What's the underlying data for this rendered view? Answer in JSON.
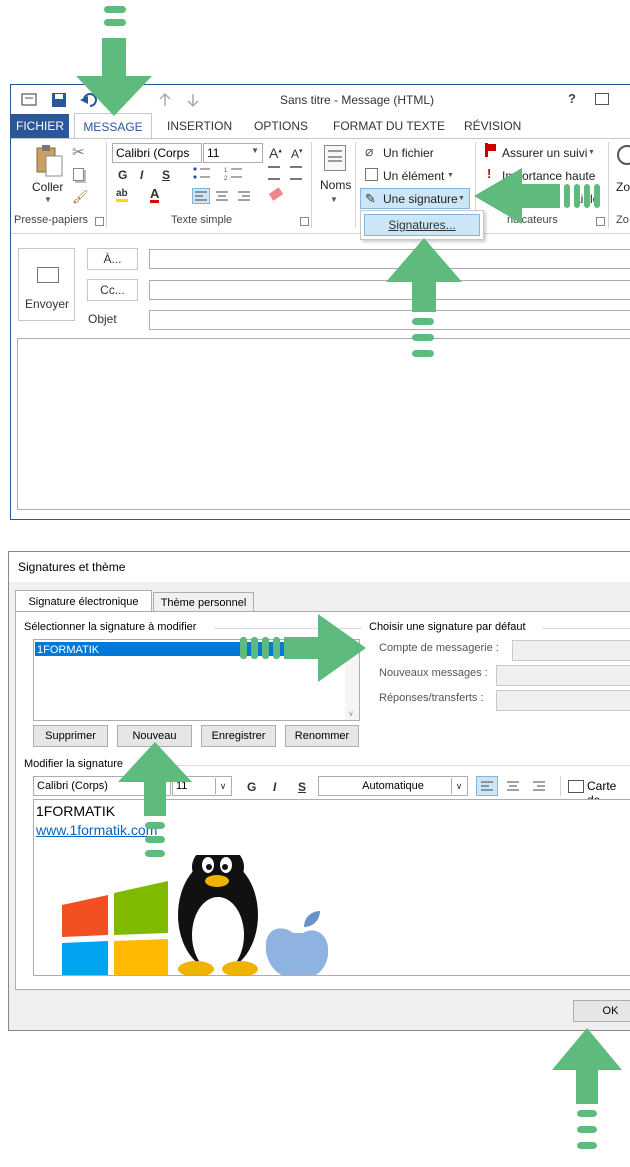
{
  "outlook": {
    "title": "Sans titre - Message (HTML)",
    "tabs": [
      "FICHIER",
      "MESSAGE",
      "INSERTION",
      "OPTIONS",
      "FORMAT DU TEXTE",
      "RÉVISION"
    ],
    "clipboard": {
      "paste": "Coller",
      "group": "Presse-papiers"
    },
    "font": {
      "name": "Calibri (Corps",
      "size": "11",
      "bold": "G",
      "italic": "I",
      "underline": "S",
      "group": "Texte simple"
    },
    "names": {
      "label": "Noms"
    },
    "include": {
      "file": "Un fichier",
      "item": "Un élément",
      "signature": "Une signature",
      "menu_signatures": "Signatures..."
    },
    "tags": {
      "follow": "Assurer un suivi",
      "importance": "Importance haute",
      "low_partial": "e",
      "group_partial": "ndicateurs",
      "low_fragment": "aible"
    },
    "zoom_partial": "Zo",
    "compose": {
      "send": "Envoyer",
      "to": "À...",
      "cc": "Cc...",
      "subject": "Objet"
    }
  },
  "dialog": {
    "title": "Signatures et thème",
    "tabs": [
      "Signature électronique",
      "Thème personnel"
    ],
    "select_label": "Sélectionner la signature à modifier",
    "signature_items": [
      "1FORMATIK"
    ],
    "buttons": {
      "delete": "Supprimer",
      "new": "Nouveau",
      "save": "Enregistrer",
      "rename": "Renommer",
      "ok": "OK"
    },
    "default_section": {
      "title": "Choisir une signature par défaut",
      "account": "Compte de messagerie :",
      "new_messages": "Nouveaux messages :",
      "replies": "Réponses/transferts :"
    },
    "edit_label": "Modifier la signature",
    "editor": {
      "font": "Calibri (Corps)",
      "size": "11",
      "bold": "G",
      "italic": "I",
      "underline": "S",
      "color": "Automatique",
      "card": "Carte de",
      "line1": "1FORMATIK",
      "line2": "www.1formatik.com"
    }
  },
  "colors": {
    "accent": "#2b579a",
    "arrow": "#5fba7d",
    "selection": "#0078d7"
  }
}
